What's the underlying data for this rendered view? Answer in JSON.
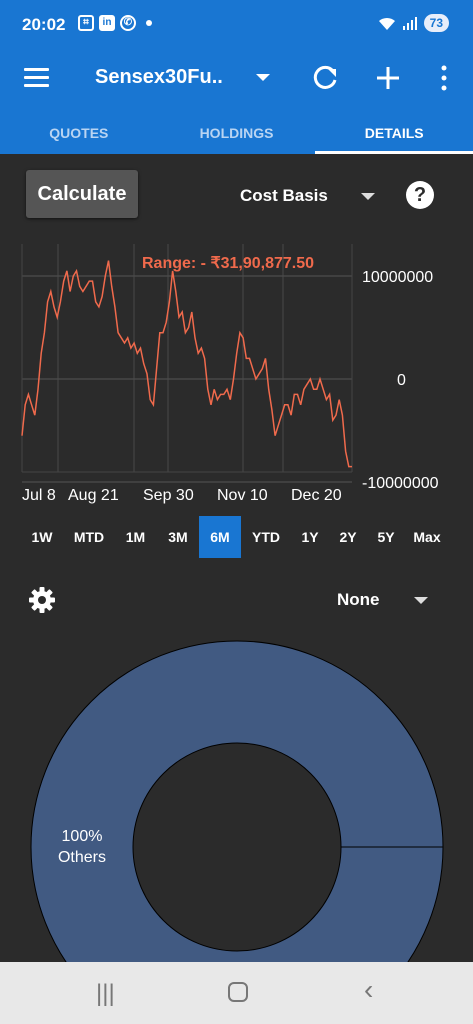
{
  "status_bar": {
    "time": "20:02",
    "battery": "73",
    "status_icons": [
      "screenshot-icon",
      "linkedin-icon",
      "whatsapp-icon"
    ]
  },
  "app_bar": {
    "title": "Sensex30Fu..",
    "icons": [
      "menu-icon",
      "refresh-icon",
      "add-icon",
      "more-vert-icon"
    ]
  },
  "tabs": [
    {
      "label": "QUOTES",
      "active": false
    },
    {
      "label": "HOLDINGS",
      "active": false
    },
    {
      "label": "DETAILS",
      "active": true
    }
  ],
  "controls": {
    "calculate_label": "Calculate",
    "cost_basis_label": "Cost Basis",
    "help_label": "?"
  },
  "chart_data": {
    "type": "line",
    "annotation": "Range: - ₹31,90,877.50",
    "x_labels": [
      "Jul 8",
      "Aug 21",
      "Sep 30",
      "Nov 10",
      "Dec 20"
    ],
    "y_tick_labels": [
      "10000000",
      "0",
      "-10000000"
    ],
    "ylim": [
      -10000000,
      10000000
    ],
    "grid": true,
    "line_color": "#f06a4c",
    "series": [
      {
        "values": [
          -5500000,
          -2500000,
          -1500000,
          -2500000,
          -3500000,
          -1000000,
          2500000,
          4500000,
          7500000,
          8500000,
          7000000,
          6000000,
          7500000,
          9500000,
          10500000,
          8500000,
          10000000,
          10500000,
          9000000,
          8500000,
          9000000,
          9500000,
          9500000,
          7500000,
          7000000,
          8000000,
          10000000,
          11500000,
          9000000,
          7000000,
          4500000,
          4000000,
          3500000,
          4000000,
          3000000,
          3500000,
          2500000,
          3000000,
          1500000,
          500000,
          -2000000,
          -2500000,
          1000000,
          4500000,
          4500000,
          5500000,
          7500000,
          10500000,
          8500000,
          6000000,
          6500000,
          4500000,
          5000000,
          6500000,
          4000000,
          2500000,
          3000000,
          2000000,
          -1000000,
          -2500000,
          -1000000,
          -2000000,
          -1500000,
          -1500000,
          -1000000,
          -2000000,
          0,
          2500000,
          4500000,
          4000000,
          2000000,
          2000000,
          1000000,
          0,
          500000,
          1000000,
          2000000,
          -1000000,
          -3000000,
          -5500000,
          -4500000,
          -3500000,
          -2500000,
          -2500000,
          -3500000,
          -1500000,
          -1500000,
          -2500000,
          -1000000,
          -500000,
          0,
          -1000000,
          -1000000,
          0,
          -1000000,
          -2000000,
          -1500000,
          -4000000,
          -3500000,
          -2000000,
          -3500000,
          -7000000,
          -8500000,
          -8500000
        ]
      }
    ]
  },
  "time_ranges": [
    {
      "label": "1W",
      "active": false
    },
    {
      "label": "MTD",
      "active": false
    },
    {
      "label": "1M",
      "active": false
    },
    {
      "label": "3M",
      "active": false
    },
    {
      "label": "6M",
      "active": true
    },
    {
      "label": "YTD",
      "active": false
    },
    {
      "label": "1Y",
      "active": false
    },
    {
      "label": "2Y",
      "active": false
    },
    {
      "label": "5Y",
      "active": false
    },
    {
      "label": "Max",
      "active": false
    }
  ],
  "allocation": {
    "grouping": "None",
    "donut": {
      "type": "pie",
      "slices": [
        {
          "label": "Others",
          "percent_label": "100%",
          "value": 100,
          "color": "#415a82"
        }
      ]
    }
  }
}
